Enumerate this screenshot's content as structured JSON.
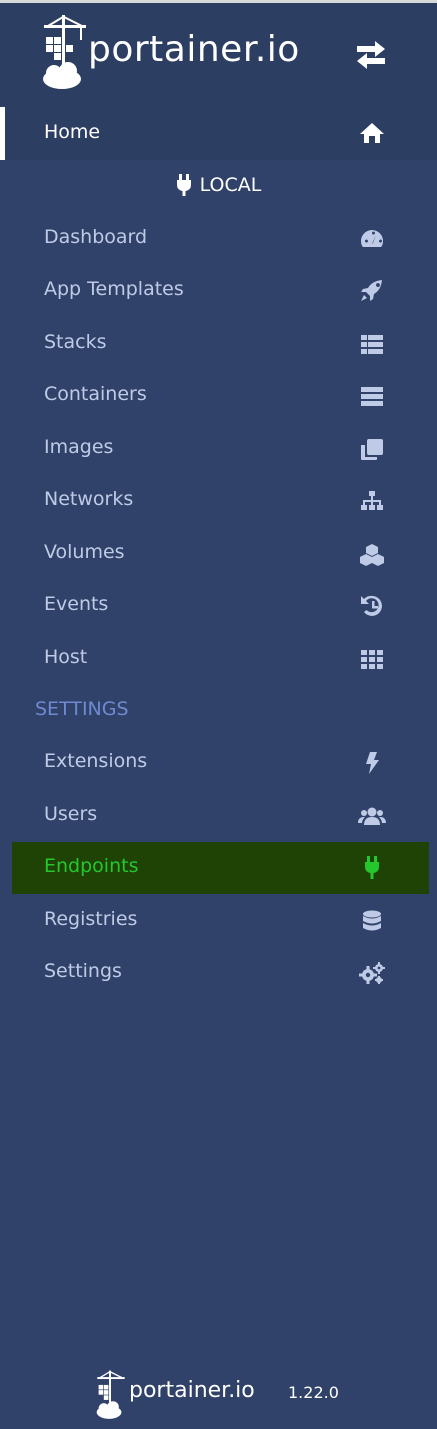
{
  "brand": {
    "name": "portainer.io"
  },
  "header": {
    "toggle_icon": "exchange-icon"
  },
  "home": {
    "label": "Home",
    "icon": "home-icon"
  },
  "endpoint": {
    "name": "LOCAL",
    "icon": "plug-icon"
  },
  "nav_items": [
    {
      "label": "Dashboard",
      "icon": "tachometer-icon"
    },
    {
      "label": "App Templates",
      "icon": "rocket-icon"
    },
    {
      "label": "Stacks",
      "icon": "th-list-icon"
    },
    {
      "label": "Containers",
      "icon": "server-icon"
    },
    {
      "label": "Images",
      "icon": "clone-icon"
    },
    {
      "label": "Networks",
      "icon": "sitemap-icon"
    },
    {
      "label": "Volumes",
      "icon": "cubes-icon"
    },
    {
      "label": "Events",
      "icon": "history-icon"
    },
    {
      "label": "Host",
      "icon": "th-icon"
    }
  ],
  "settings_section": {
    "title": "SETTINGS"
  },
  "settings_items": [
    {
      "label": "Extensions",
      "icon": "bolt-icon"
    },
    {
      "label": "Users",
      "icon": "users-icon"
    },
    {
      "label": "Endpoints",
      "icon": "plug-icon",
      "active": true
    },
    {
      "label": "Registries",
      "icon": "database-icon"
    },
    {
      "label": "Settings",
      "icon": "cogs-icon"
    }
  ],
  "footer": {
    "brand": "portainer.io",
    "version": "1.22.0"
  },
  "colors": {
    "sidebar_bg": "#30426a",
    "header_bg": "#2d3e63",
    "active_bg": "#1e4305",
    "active_text": "#24c82c",
    "item_text": "#bfcbe6",
    "section_text": "#6f8ad0"
  }
}
